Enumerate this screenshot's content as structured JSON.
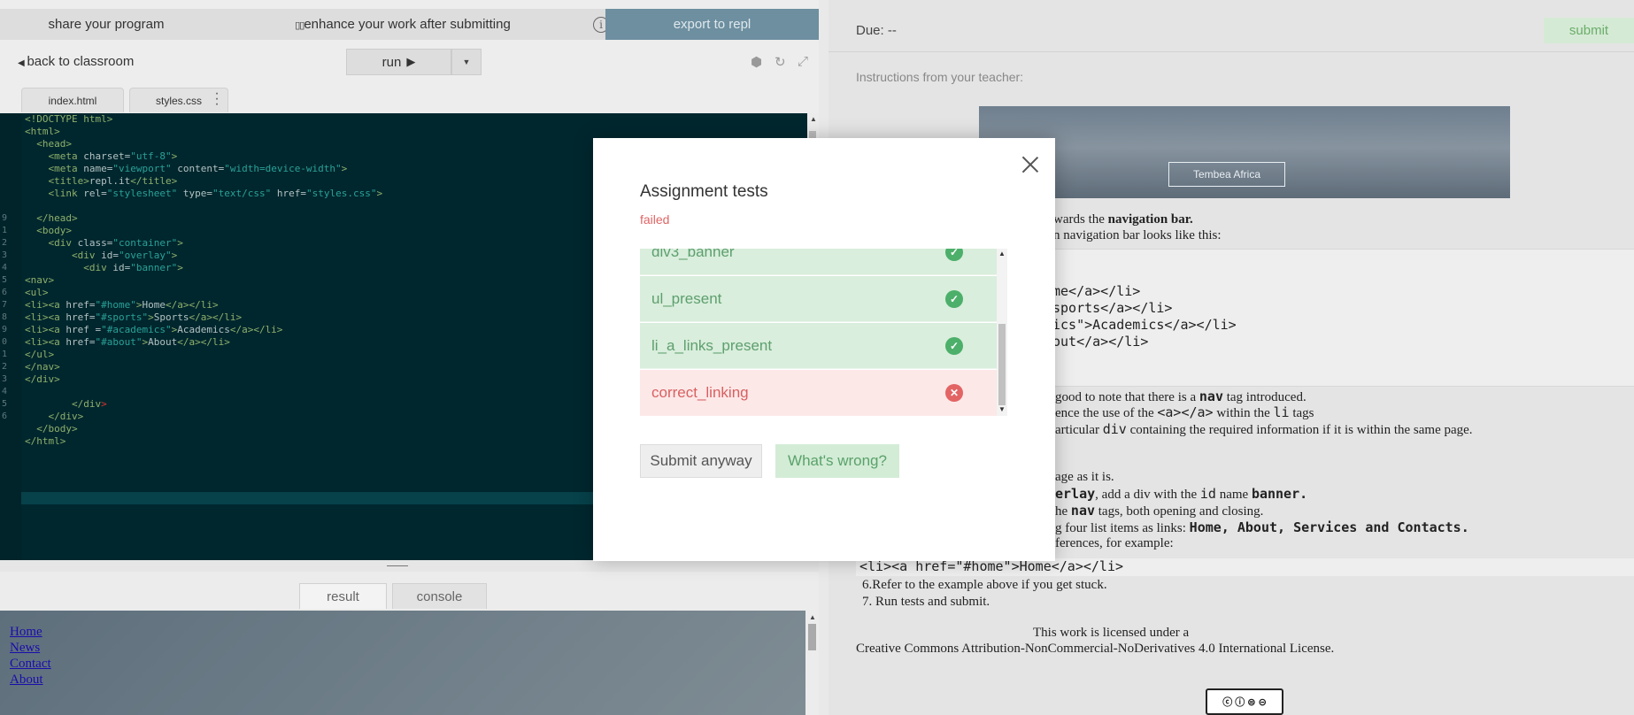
{
  "topbar": {
    "share_label": "share your program",
    "enhance_label": "enhance your work after submitting",
    "info_icon": "info-icon",
    "export_label": "export to repl"
  },
  "toolbar": {
    "back_label": "back to classroom",
    "run_label": "run",
    "run_icon": "play-icon",
    "dropdown_icon": "chevron-down-icon",
    "icons": [
      "package-icon",
      "refresh-icon",
      "expand-icon"
    ]
  },
  "tabs": [
    {
      "label": "index.html"
    },
    {
      "label": "styles.css"
    }
  ],
  "editor": {
    "line_numbers": [
      "",
      "",
      "",
      "",
      "",
      "",
      "",
      "",
      "9",
      "1",
      "2",
      "3",
      "4",
      "5",
      "6",
      "7",
      "8",
      "9",
      "0",
      "1",
      "2",
      "3",
      "4",
      "5",
      "6"
    ]
  },
  "output": {
    "tabs": [
      "result",
      "console"
    ],
    "links": [
      "Home",
      "News",
      "Contact",
      "About"
    ]
  },
  "instructions": {
    "due_label": "Due: --",
    "submit_label": "submit",
    "heading": "Instructions from your teacher:",
    "banner_title": "Tembea Africa",
    "line1_pre": "wards the ",
    "line1_bold": "navigation bar.",
    "line2": "n navigation bar looks like this:",
    "code_lines": [
      "me</a></li>",
      "sports</a></li>",
      "ics\">Academics</a></li>",
      "out</a></li>"
    ],
    "line3_pre": "good to note that there is a ",
    "line3_bold": "nav",
    "line3_post": " tag introduced.",
    "line4_pre": "ence the use of the ",
    "line4_code": "<a></a>",
    "line4_mid": "  within the ",
    "line4_code2": "li",
    "line4_post": "  tags",
    "line5_pre": "articular ",
    "line5_code": "div",
    "line5_post": " containing the required information if it is within the same page.",
    "line6": "age as it is.",
    "line7_code": "erlay",
    "line7_mid": ", add a div with the ",
    "line7_code2": "id",
    "line7_mid2": " name ",
    "line7_bold": "banner.",
    "line8_pre": "he ",
    "line8_bold": "nav",
    "line8_post": " tags, both opening and closing.",
    "line9_pre": "g four list items as links: ",
    "line9_bold": "Home, About, Services and Contacts.",
    "line10": "ferences, for example:",
    "example_code": "<li><a href=\"#home\">Home</a></li>",
    "step6": "6.Refer to the example above if you get stuck.",
    "step7": "7. Run tests and submit.",
    "license1": "This work is licensed under a",
    "license2": "Creative Commons Attribution-NonCommercial-NoDerivatives 4.0 International License.",
    "cc_badge": "cc-by-nc-nd-badge"
  },
  "modal": {
    "title": "Assignment tests",
    "status": "failed",
    "tests": [
      {
        "name": "div3_banner",
        "result": "pass"
      },
      {
        "name": "ul_present",
        "result": "pass"
      },
      {
        "name": "li_a_links_present",
        "result": "pass"
      },
      {
        "name": "correct_linking",
        "result": "fail"
      }
    ],
    "submit_anyway_label": "Submit anyway",
    "whats_wrong_label": "What's wrong?"
  },
  "colors": {
    "editor_bg": "#00272e",
    "export_bg": "#6d8fa0",
    "pass_bg": "#d9eedc",
    "fail_bg": "#fde8e8",
    "fail_text": "#e06464"
  }
}
